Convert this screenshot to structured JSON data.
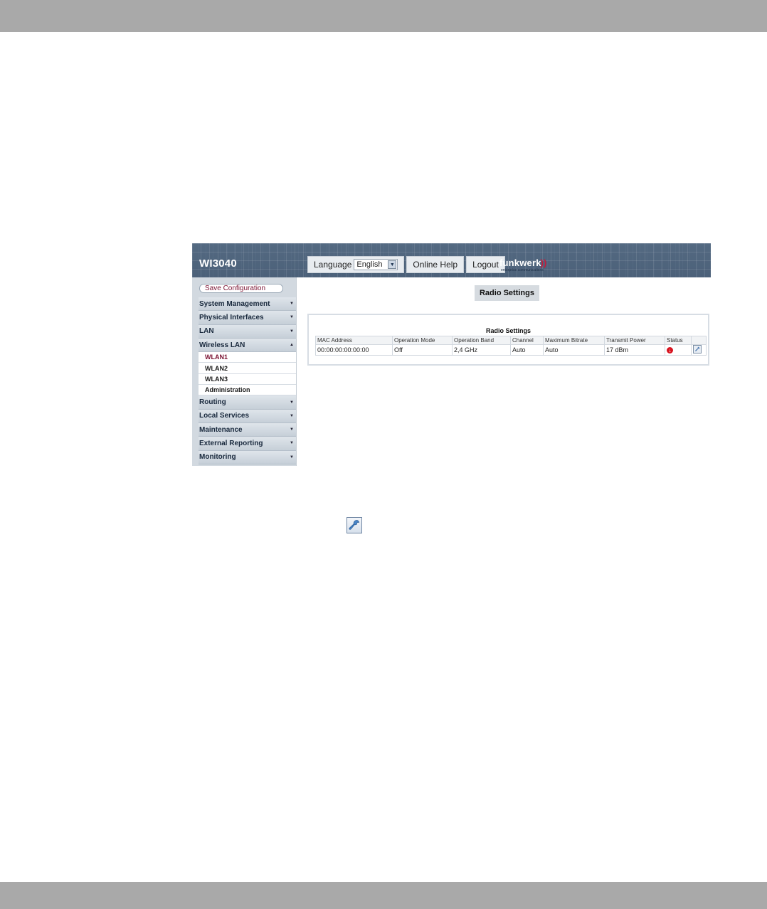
{
  "device": {
    "name": "WI3040"
  },
  "topbar": {
    "language_label": "Language",
    "language_value": "English",
    "online_help": "Online Help",
    "logout": "Logout"
  },
  "logo": {
    "word": "funkwerk",
    "waves": "))",
    "subtitle": "enterprise communications"
  },
  "sidebar": {
    "save": "Save Configuration",
    "items": [
      {
        "label": "System Management",
        "expanded": false
      },
      {
        "label": "Physical Interfaces",
        "expanded": false
      },
      {
        "label": "LAN",
        "expanded": false
      },
      {
        "label": "Wireless LAN",
        "expanded": true,
        "children": [
          {
            "label": "WLAN1",
            "active": true
          },
          {
            "label": "WLAN2",
            "active": false
          },
          {
            "label": "WLAN3",
            "active": false
          },
          {
            "label": "Administration",
            "active": false
          }
        ]
      },
      {
        "label": "Routing",
        "expanded": false
      },
      {
        "label": "Local Services",
        "expanded": false
      },
      {
        "label": "Maintenance",
        "expanded": false
      },
      {
        "label": "External Reporting",
        "expanded": false
      },
      {
        "label": "Monitoring",
        "expanded": false
      }
    ]
  },
  "main": {
    "page_title": "Radio Settings",
    "box_title": "Radio Settings",
    "columns": [
      "MAC Address",
      "Operation Mode",
      "Operation Band",
      "Channel",
      "Maximum Bitrate",
      "Transmit Power",
      "Status",
      ""
    ],
    "rows": [
      [
        "00:00:00:00:00:00",
        "Off",
        "2,4 GHz",
        "Auto",
        "Auto",
        "17 dBm",
        "",
        ""
      ]
    ],
    "status_color": "#d8121e"
  },
  "icons": {
    "status": "status-off-icon",
    "edit": "wrench-icon"
  }
}
